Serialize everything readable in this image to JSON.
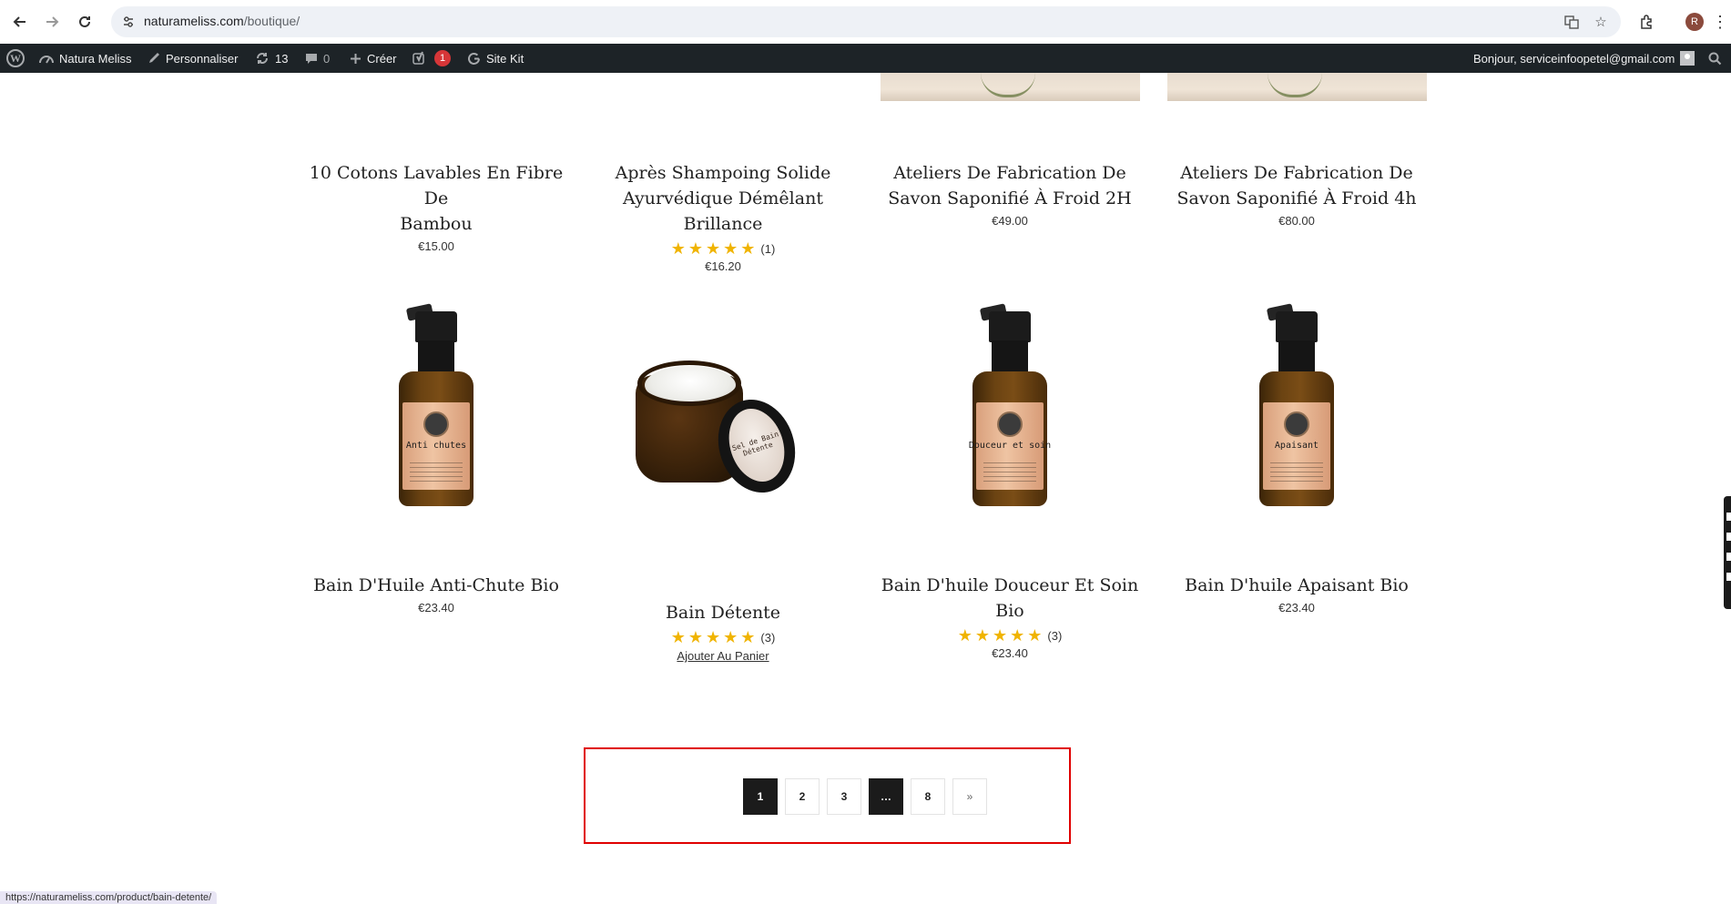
{
  "browser": {
    "url_host": "naturameliss.com",
    "url_path": "/boutique/",
    "back_icon": "arrow-left-icon",
    "forward_icon": "arrow-right-icon",
    "reload_icon": "reload-icon",
    "profile_initial": "R"
  },
  "adminbar": {
    "site_name": "Natura Meliss",
    "customize": "Personnaliser",
    "updates_count": "13",
    "comments_count": "0",
    "new_label": "Créer",
    "yoast_badge": "1",
    "sitekit_label": "Site Kit",
    "greeting": "Bonjour, serviceinfoopetel@gmail.com"
  },
  "products_row1": [
    {
      "title_l1": "10 Cotons Lavables En Fibre De",
      "title_l2": "Bambou",
      "price": "€15.00"
    },
    {
      "title_l1": "Après Shampoing Solide",
      "title_l2": "Ayurvédique Démêlant Brillance",
      "rating_count": "(1)",
      "price": "€16.20"
    },
    {
      "title_l1": "Ateliers De Fabrication De",
      "title_l2": "Savon Saponifié À Froid 2H",
      "price": "€49.00"
    },
    {
      "title_l1": "Ateliers De Fabrication De",
      "title_l2": "Savon Saponifié À Froid 4h",
      "price": "€80.00"
    }
  ],
  "products_row2": [
    {
      "title_l1": "Bain D'Huile Anti-Chute Bio",
      "price": "€23.40",
      "label": "Anti chutes"
    },
    {
      "title_l1": "Bain Détente",
      "rating_count": "(3)",
      "cta": "Ajouter Au Panier",
      "label": "Sel de Bain Détente"
    },
    {
      "title_l1": "Bain D'huile Douceur Et Soin",
      "title_l2": "Bio",
      "rating_count": "(3)",
      "price": "€23.40",
      "label": "Douceur et soin"
    },
    {
      "title_l1": "Bain D'huile Apaisant Bio",
      "price": "€23.40",
      "label": "Apaisant"
    }
  ],
  "stars": "★",
  "pagination": {
    "pages": [
      "1",
      "2",
      "3",
      "…",
      "8",
      "»"
    ],
    "current": "1"
  },
  "status_url": "https://naturameliss.com/product/bain-detente/"
}
